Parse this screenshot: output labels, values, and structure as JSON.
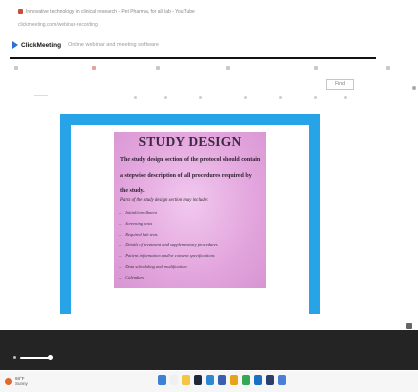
{
  "browser": {
    "tab_title": "Innovative technology in clinical research - Pet Pharma, for all lab - YouTube",
    "url_text": "clickmeeting.com/webinar-recording",
    "brand": "ClickMeeting",
    "brand_tagline": "Online webinar and meeting software"
  },
  "toolbar": {
    "find_label": "Find",
    "accent_color": "#27a4e8"
  },
  "slide": {
    "title": "STUDY DESIGN",
    "lines": [
      "The study design section of the protocol should contain",
      "a stepwise description of all procedures required by",
      "the study."
    ],
    "intro": "Parts of the study design section may include:",
    "bullets": [
      "Initial/enrollment",
      "Screening tests",
      "Required lab tests",
      "Details of treatment and supplementary procedures",
      "Patient information and/or consent specifications",
      "Data scheduling and modification",
      "Calendars"
    ]
  },
  "player": {
    "progress": 0.08
  },
  "taskbar": {
    "weather_temp": "68°F",
    "weather_desc": "Sunny"
  }
}
